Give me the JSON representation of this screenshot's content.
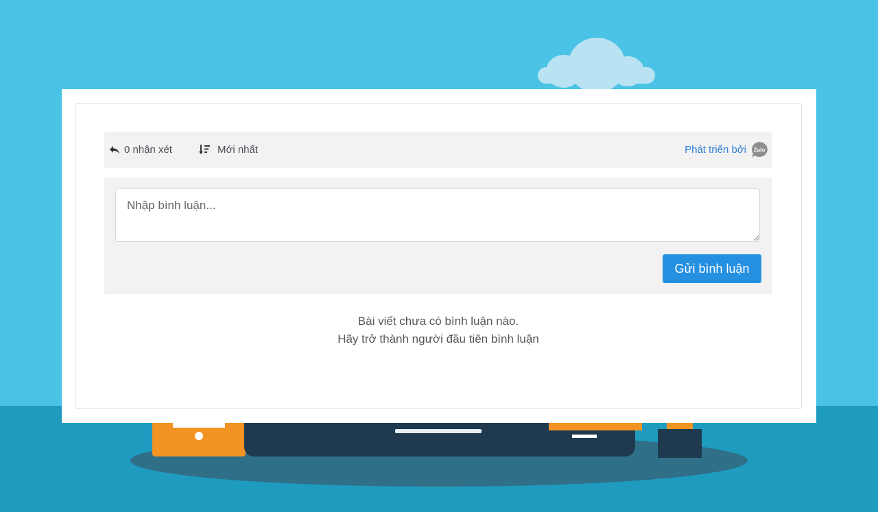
{
  "colors": {
    "sky": "#4ac3e6",
    "ground": "#1f9bc0",
    "accent": "#2590e0",
    "link": "#2a7ed6"
  },
  "toolbar": {
    "comment_count_label": "0 nhận xét",
    "comment_icon": "reply-arrow-icon",
    "sort_label": "Mới nhất",
    "sort_icon": "sort-descending-icon",
    "powered_by_label": "Phát triển bởi",
    "powered_by_logo": "zalo-logo-icon",
    "logo_text": "Zalo"
  },
  "composer": {
    "placeholder": "Nhập bình luận...",
    "value": "",
    "submit_label": "Gửi bình luận"
  },
  "empty_state": {
    "line1": "Bài viết chưa có bình luận nào.",
    "line2": "Hãy trở thành người đầu tiên bình luận"
  }
}
